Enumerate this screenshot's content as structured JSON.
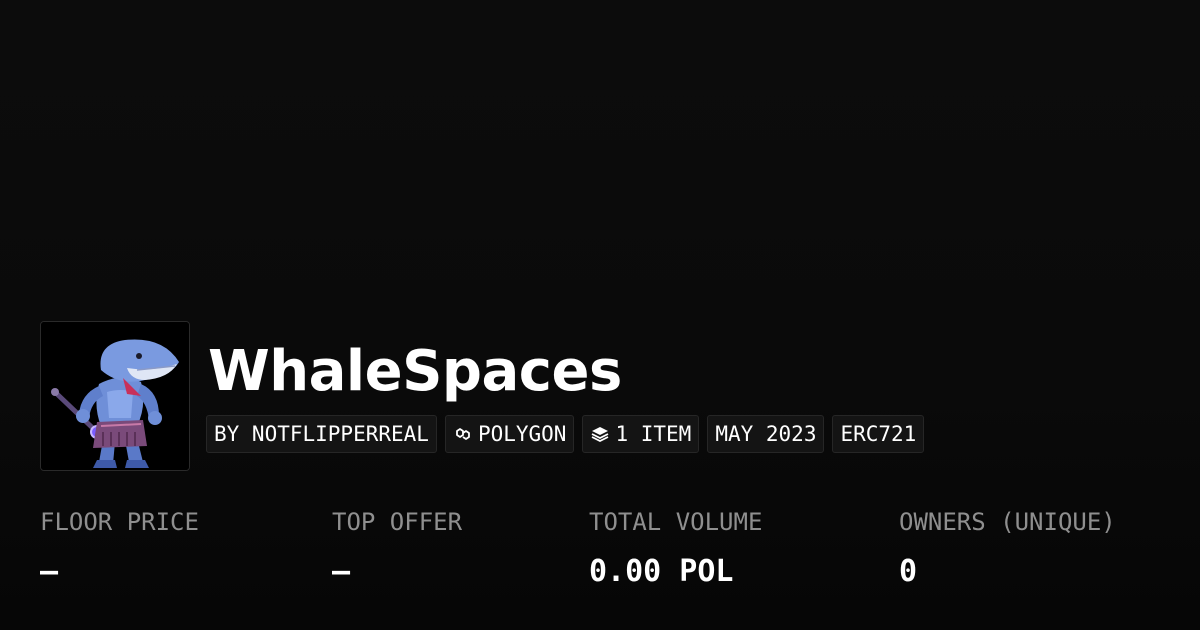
{
  "collection": {
    "name": "WhaleSpaces",
    "avatar_icon": "whale-warrior-avatar"
  },
  "badges": [
    {
      "label": "BY NOTFLIPPERREAL",
      "icon": null
    },
    {
      "label": "POLYGON",
      "icon": "polygon-chain-icon"
    },
    {
      "label": "1 ITEM",
      "icon": "layers-icon"
    },
    {
      "label": "MAY 2023",
      "icon": null
    },
    {
      "label": "ERC721",
      "icon": null
    }
  ],
  "stats": [
    {
      "label": "FLOOR PRICE",
      "value": "–"
    },
    {
      "label": "TOP OFFER",
      "value": "–"
    },
    {
      "label": "TOTAL VOLUME",
      "value": "0.00 POL"
    },
    {
      "label": "OWNERS (UNIQUE)",
      "value": "0"
    }
  ],
  "colors": {
    "background": "#0a0a0a",
    "badge_bg": "#141414",
    "label_gray": "#8f8f8f",
    "text": "#ffffff"
  }
}
